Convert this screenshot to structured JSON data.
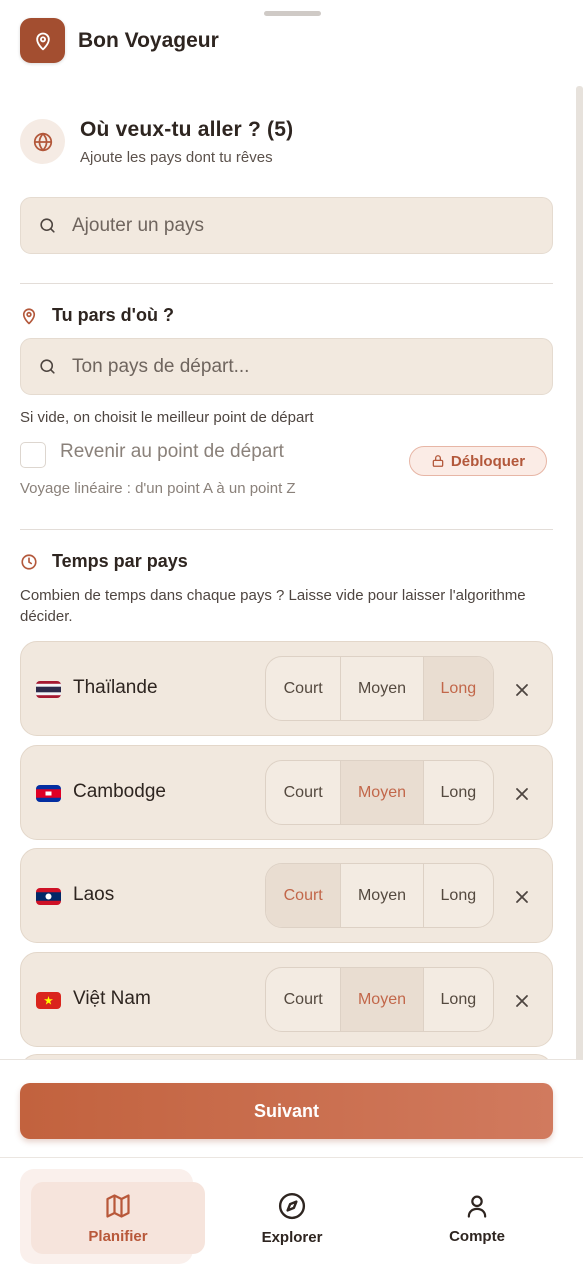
{
  "app": {
    "title": "Bon Voyageur",
    "logo_icon": "map-pin-icon",
    "brand_color": "#a34e30"
  },
  "destinations": {
    "title": "Où veux-tu aller ? (5)",
    "subtitle": "Ajoute les pays dont tu rêves",
    "search_placeholder": "Ajouter un pays"
  },
  "departure": {
    "title": "Tu pars d'où ?",
    "search_placeholder": "Ton pays de départ...",
    "hint": "Si vide, on choisit le meilleur point de départ",
    "return_label": "Revenir au point de départ",
    "return_checked": false,
    "unlock_label": "Débloquer",
    "linear_hint": "Voyage linéaire : d'un point A à un point Z"
  },
  "time_per_country": {
    "title": "Temps par pays",
    "hint": "Combien de temps dans chaque pays ? Laisse vide pour laisser l'algorithme décider.",
    "options": [
      "Court",
      "Moyen",
      "Long"
    ],
    "countries": [
      {
        "name": "Thaïlande",
        "flag": "thailand",
        "selected": "Long"
      },
      {
        "name": "Cambodge",
        "flag": "cambodia",
        "selected": "Moyen"
      },
      {
        "name": "Laos",
        "flag": "laos",
        "selected": "Court"
      },
      {
        "name": "Việt Nam",
        "flag": "vietnam",
        "selected": "Moyen"
      }
    ]
  },
  "actions": {
    "next_label": "Suivant"
  },
  "nav": {
    "items": [
      {
        "label": "Planifier",
        "icon": "map-icon",
        "active": true
      },
      {
        "label": "Explorer",
        "icon": "compass-icon",
        "active": false
      },
      {
        "label": "Compte",
        "icon": "user-icon",
        "active": false
      }
    ]
  },
  "colors": {
    "accent": "#c2674a",
    "selected_bg": "#e9ddd1",
    "card_bg": "#f1e8de"
  }
}
